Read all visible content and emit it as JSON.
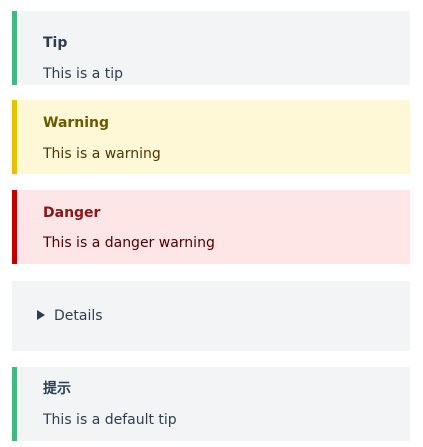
{
  "tip": {
    "title": "Tip",
    "text": "This is a tip",
    "accent": "#42b883"
  },
  "warning": {
    "title": "Warning",
    "text": "This is a warning",
    "accent": "#e7c000"
  },
  "danger": {
    "title": "Danger",
    "text": "This is a danger warning",
    "accent": "#c00000"
  },
  "details": {
    "summary": "Details",
    "icon": "triangle-right-icon"
  },
  "default_tip": {
    "title": "提示",
    "text": "This is a default tip",
    "accent": "#42b883"
  }
}
